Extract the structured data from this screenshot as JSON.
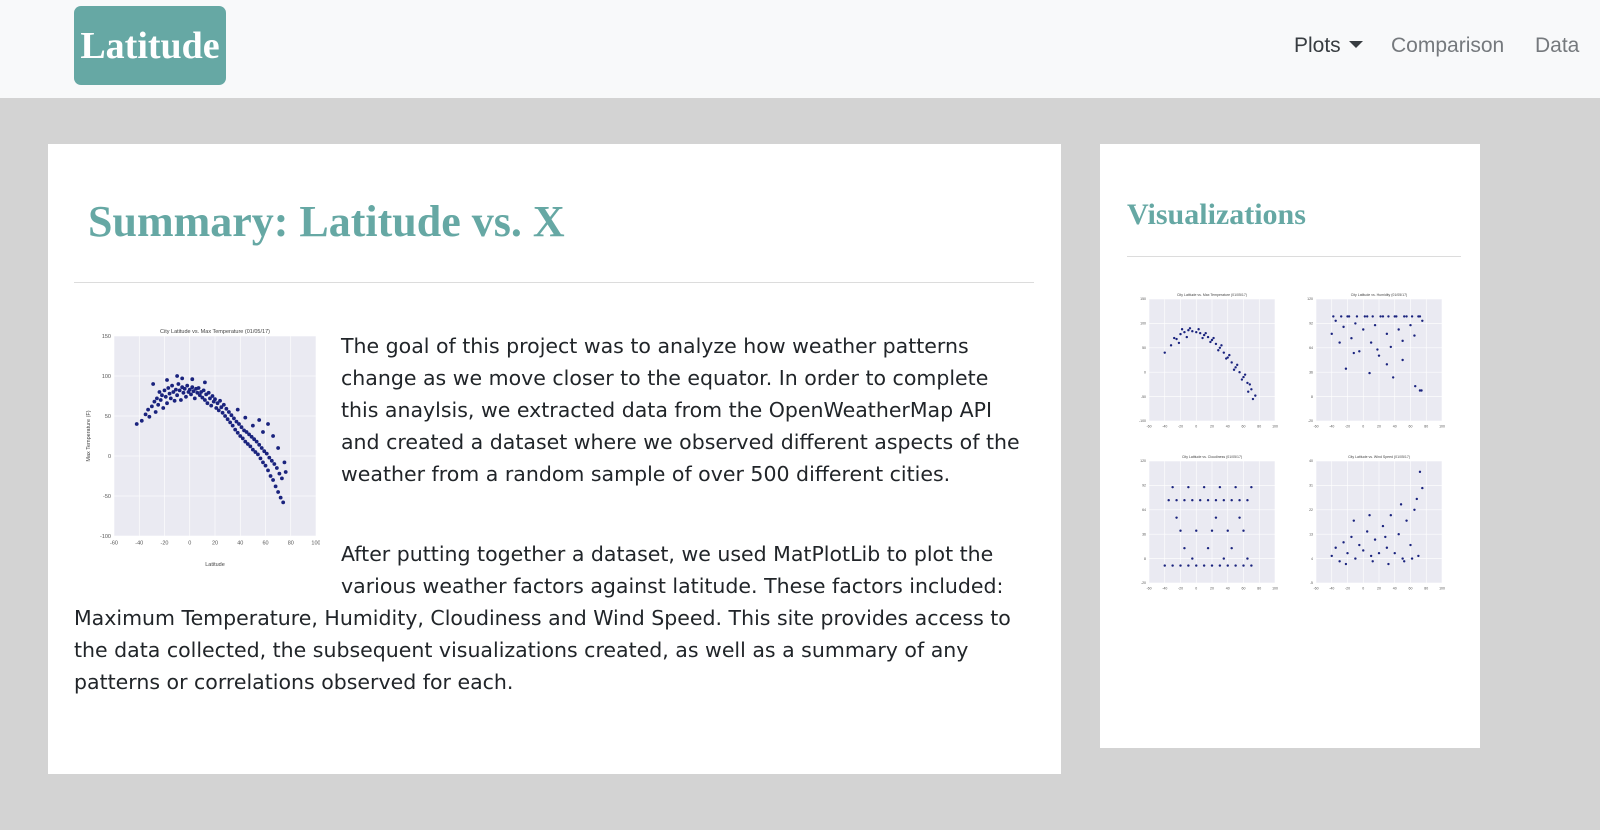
{
  "navbar": {
    "brand": "Latitude",
    "items": [
      {
        "label": "Plots",
        "dropdown": true
      },
      {
        "label": "Comparison"
      },
      {
        "label": "Data"
      }
    ]
  },
  "summary": {
    "title": "Summary: Latitude vs. X",
    "paragraph1": "The goal of this project was to analyze how weather patterns change as we move closer to the equator. In order to complete this anaylsis, we extracted data from the OpenWeatherMap API and created a dataset where we observed different aspects of the weather from a random sample of over 500 different cities.",
    "paragraph2_part1": "After putting together a dataset, we used MatPlotLib to plot the various weather factors against latitude. These factors included:",
    "paragraph2_part2": "Maximum Temperature, Humidity, Cloudiness and Wind Speed. This site provides access to the data collected, the subsequent visualizations created, as well as a summary of any patterns or correlations observed for each."
  },
  "sidebar": {
    "title": "Visualizations"
  },
  "colors": {
    "brand": "#66a8a4",
    "points": "#1a237e",
    "plot_bg": "#eaeaf2"
  },
  "chart_data": [
    {
      "id": "main",
      "type": "scatter",
      "title": "City Latitude vs. Max Temperature (01/05/17)",
      "xlabel": "Latitude",
      "ylabel": "Max Temperature (F)",
      "xlim": [
        -60,
        100
      ],
      "ylim": [
        -100,
        150
      ],
      "xticks": [
        -60,
        -40,
        -20,
        0,
        20,
        40,
        60,
        80,
        100
      ],
      "yticks": [
        -100,
        -50,
        0,
        50,
        100,
        150
      ],
      "points": [
        [
          -42,
          40
        ],
        [
          -38,
          44
        ],
        [
          -35,
          52
        ],
        [
          -33,
          58
        ],
        [
          -32,
          49
        ],
        [
          -30,
          62
        ],
        [
          -28,
          68
        ],
        [
          -27,
          55
        ],
        [
          -26,
          72
        ],
        [
          -25,
          64
        ],
        [
          -24,
          80
        ],
        [
          -23,
          70
        ],
        [
          -22,
          76
        ],
        [
          -21,
          60
        ],
        [
          -20,
          82
        ],
        [
          -19,
          74
        ],
        [
          -18,
          66
        ],
        [
          -17,
          85
        ],
        [
          -16,
          78
        ],
        [
          -15,
          72
        ],
        [
          -14,
          88
        ],
        [
          -13,
          80
        ],
        [
          -12,
          69
        ],
        [
          -11,
          83
        ],
        [
          -10,
          76
        ],
        [
          -9,
          90
        ],
        [
          -8,
          82
        ],
        [
          -7,
          70
        ],
        [
          -6,
          86
        ],
        [
          -5,
          79
        ],
        [
          -4,
          84
        ],
        [
          -3,
          74
        ],
        [
          -2,
          88
        ],
        [
          -1,
          80
        ],
        [
          0,
          83
        ],
        [
          1,
          77
        ],
        [
          2,
          86
        ],
        [
          3,
          81
        ],
        [
          4,
          72
        ],
        [
          5,
          84
        ],
        [
          6,
          79
        ],
        [
          7,
          85
        ],
        [
          8,
          76
        ],
        [
          9,
          80
        ],
        [
          10,
          73
        ],
        [
          11,
          82
        ],
        [
          12,
          70
        ],
        [
          13,
          77
        ],
        [
          14,
          66
        ],
        [
          15,
          79
        ],
        [
          16,
          72
        ],
        [
          17,
          63
        ],
        [
          18,
          75
        ],
        [
          19,
          68
        ],
        [
          20,
          71
        ],
        [
          21,
          60
        ],
        [
          22,
          66
        ],
        [
          23,
          57
        ],
        [
          24,
          69
        ],
        [
          25,
          61
        ],
        [
          26,
          54
        ],
        [
          27,
          64
        ],
        [
          28,
          50
        ],
        [
          29,
          59
        ],
        [
          30,
          46
        ],
        [
          31,
          55
        ],
        [
          32,
          42
        ],
        [
          33,
          51
        ],
        [
          34,
          38
        ],
        [
          35,
          47
        ],
        [
          36,
          33
        ],
        [
          37,
          43
        ],
        [
          38,
          29
        ],
        [
          39,
          40
        ],
        [
          40,
          25
        ],
        [
          41,
          36
        ],
        [
          42,
          22
        ],
        [
          43,
          32
        ],
        [
          44,
          18
        ],
        [
          45,
          30
        ],
        [
          46,
          15
        ],
        [
          47,
          27
        ],
        [
          48,
          12
        ],
        [
          49,
          24
        ],
        [
          50,
          8
        ],
        [
          51,
          21
        ],
        [
          52,
          5
        ],
        [
          53,
          18
        ],
        [
          54,
          2
        ],
        [
          55,
          14
        ],
        [
          56,
          -3
        ],
        [
          57,
          10
        ],
        [
          58,
          -8
        ],
        [
          59,
          6
        ],
        [
          60,
          -12
        ],
        [
          61,
          3
        ],
        [
          62,
          -18
        ],
        [
          63,
          -2
        ],
        [
          64,
          -25
        ],
        [
          65,
          -6
        ],
        [
          66,
          -30
        ],
        [
          67,
          -10
        ],
        [
          68,
          -38
        ],
        [
          69,
          -15
        ],
        [
          70,
          -45
        ],
        [
          71,
          -22
        ],
        [
          72,
          -52
        ],
        [
          73,
          -28
        ],
        [
          74,
          -58
        ],
        [
          75,
          -8
        ],
        [
          62,
          40
        ],
        [
          58,
          30
        ],
        [
          66,
          25
        ],
        [
          70,
          10
        ],
        [
          55,
          45
        ],
        [
          76,
          -20
        ],
        [
          -29,
          90
        ],
        [
          -18,
          95
        ],
        [
          -10,
          100
        ],
        [
          -6,
          97
        ],
        [
          2,
          96
        ],
        [
          12,
          92
        ],
        [
          38,
          58
        ],
        [
          44,
          48
        ],
        [
          50,
          38
        ]
      ]
    },
    {
      "id": "temperature",
      "type": "scatter",
      "title": "City Latitude vs. Max Temperature (01/05/17)",
      "points": [
        [
          -40,
          40
        ],
        [
          -32,
          55
        ],
        [
          -25,
          68
        ],
        [
          -20,
          78
        ],
        [
          -15,
          82
        ],
        [
          -10,
          86
        ],
        [
          -5,
          84
        ],
        [
          0,
          82
        ],
        [
          5,
          80
        ],
        [
          10,
          76
        ],
        [
          15,
          72
        ],
        [
          20,
          66
        ],
        [
          25,
          58
        ],
        [
          30,
          50
        ],
        [
          35,
          40
        ],
        [
          40,
          30
        ],
        [
          45,
          20
        ],
        [
          50,
          10
        ],
        [
          55,
          0
        ],
        [
          60,
          -10
        ],
        [
          65,
          -22
        ],
        [
          70,
          -35
        ],
        [
          75,
          -48
        ],
        [
          -28,
          70
        ],
        [
          -18,
          88
        ],
        [
          -8,
          90
        ],
        [
          3,
          88
        ],
        [
          12,
          80
        ],
        [
          22,
          70
        ],
        [
          32,
          55
        ],
        [
          42,
          35
        ],
        [
          52,
          15
        ],
        [
          62,
          -5
        ],
        [
          68,
          -25
        ],
        [
          -22,
          60
        ],
        [
          -12,
          72
        ],
        [
          8,
          70
        ],
        [
          18,
          62
        ],
        [
          28,
          45
        ],
        [
          38,
          28
        ],
        [
          48,
          5
        ],
        [
          58,
          -15
        ],
        [
          66,
          -40
        ],
        [
          72,
          -55
        ]
      ]
    },
    {
      "id": "humidity",
      "type": "scatter",
      "title": "City Latitude vs. Humidity (01/05/17)",
      "points": [
        [
          -40,
          80
        ],
        [
          -35,
          95
        ],
        [
          -30,
          70
        ],
        [
          -25,
          88
        ],
        [
          -20,
          100
        ],
        [
          -15,
          75
        ],
        [
          -10,
          92
        ],
        [
          -5,
          60
        ],
        [
          0,
          85
        ],
        [
          5,
          100
        ],
        [
          10,
          70
        ],
        [
          15,
          90
        ],
        [
          20,
          55
        ],
        [
          25,
          100
        ],
        [
          30,
          80
        ],
        [
          35,
          65
        ],
        [
          40,
          100
        ],
        [
          45,
          85
        ],
        [
          50,
          72
        ],
        [
          55,
          100
        ],
        [
          60,
          90
        ],
        [
          65,
          78
        ],
        [
          70,
          100
        ],
        [
          75,
          95
        ],
        [
          -38,
          100
        ],
        [
          -28,
          100
        ],
        [
          -18,
          100
        ],
        [
          -8,
          100
        ],
        [
          2,
          100
        ],
        [
          12,
          100
        ],
        [
          22,
          100
        ],
        [
          32,
          100
        ],
        [
          42,
          100
        ],
        [
          52,
          100
        ],
        [
          62,
          100
        ],
        [
          72,
          100
        ],
        [
          -22,
          40
        ],
        [
          8,
          35
        ],
        [
          30,
          45
        ],
        [
          50,
          50
        ],
        [
          66,
          20
        ],
        [
          72,
          15
        ],
        [
          74,
          15
        ],
        [
          -12,
          58
        ],
        [
          18,
          62
        ],
        [
          38,
          30
        ]
      ]
    },
    {
      "id": "cloudiness",
      "type": "scatter",
      "title": "City Latitude vs. Cloudiness (01/05/17)",
      "points": [
        [
          -40,
          0
        ],
        [
          -30,
          0
        ],
        [
          -20,
          0
        ],
        [
          -10,
          0
        ],
        [
          0,
          0
        ],
        [
          10,
          0
        ],
        [
          20,
          0
        ],
        [
          30,
          0
        ],
        [
          40,
          0
        ],
        [
          50,
          0
        ],
        [
          60,
          0
        ],
        [
          70,
          0
        ],
        [
          -35,
          75
        ],
        [
          -25,
          75
        ],
        [
          -15,
          75
        ],
        [
          -5,
          75
        ],
        [
          5,
          75
        ],
        [
          15,
          75
        ],
        [
          25,
          75
        ],
        [
          35,
          75
        ],
        [
          45,
          75
        ],
        [
          55,
          75
        ],
        [
          65,
          75
        ],
        [
          -30,
          90
        ],
        [
          -10,
          90
        ],
        [
          10,
          90
        ],
        [
          30,
          90
        ],
        [
          50,
          90
        ],
        [
          70,
          90
        ],
        [
          -20,
          40
        ],
        [
          0,
          40
        ],
        [
          20,
          40
        ],
        [
          40,
          40
        ],
        [
          60,
          40
        ],
        [
          -15,
          20
        ],
        [
          15,
          20
        ],
        [
          45,
          20
        ],
        [
          -25,
          55
        ],
        [
          25,
          55
        ],
        [
          55,
          55
        ],
        [
          -5,
          8
        ],
        [
          35,
          8
        ],
        [
          65,
          8
        ]
      ]
    },
    {
      "id": "wind",
      "type": "scatter",
      "title": "City Latitude vs. Wind Speed (01/05/17)",
      "points": [
        [
          -40,
          5
        ],
        [
          -35,
          8
        ],
        [
          -30,
          3
        ],
        [
          -25,
          10
        ],
        [
          -20,
          6
        ],
        [
          -15,
          12
        ],
        [
          -10,
          4
        ],
        [
          -5,
          9
        ],
        [
          0,
          7
        ],
        [
          5,
          14
        ],
        [
          10,
          5
        ],
        [
          15,
          11
        ],
        [
          20,
          6
        ],
        [
          25,
          16
        ],
        [
          30,
          8
        ],
        [
          35,
          20
        ],
        [
          40,
          6
        ],
        [
          45,
          13
        ],
        [
          50,
          4
        ],
        [
          55,
          18
        ],
        [
          60,
          9
        ],
        [
          65,
          22
        ],
        [
          70,
          5
        ],
        [
          75,
          30
        ],
        [
          72,
          36
        ],
        [
          68,
          26
        ],
        [
          -22,
          2
        ],
        [
          12,
          3
        ],
        [
          32,
          2
        ],
        [
          52,
          3
        ],
        [
          62,
          4
        ],
        [
          -12,
          18
        ],
        [
          8,
          20
        ],
        [
          28,
          12
        ],
        [
          48,
          24
        ]
      ]
    }
  ]
}
